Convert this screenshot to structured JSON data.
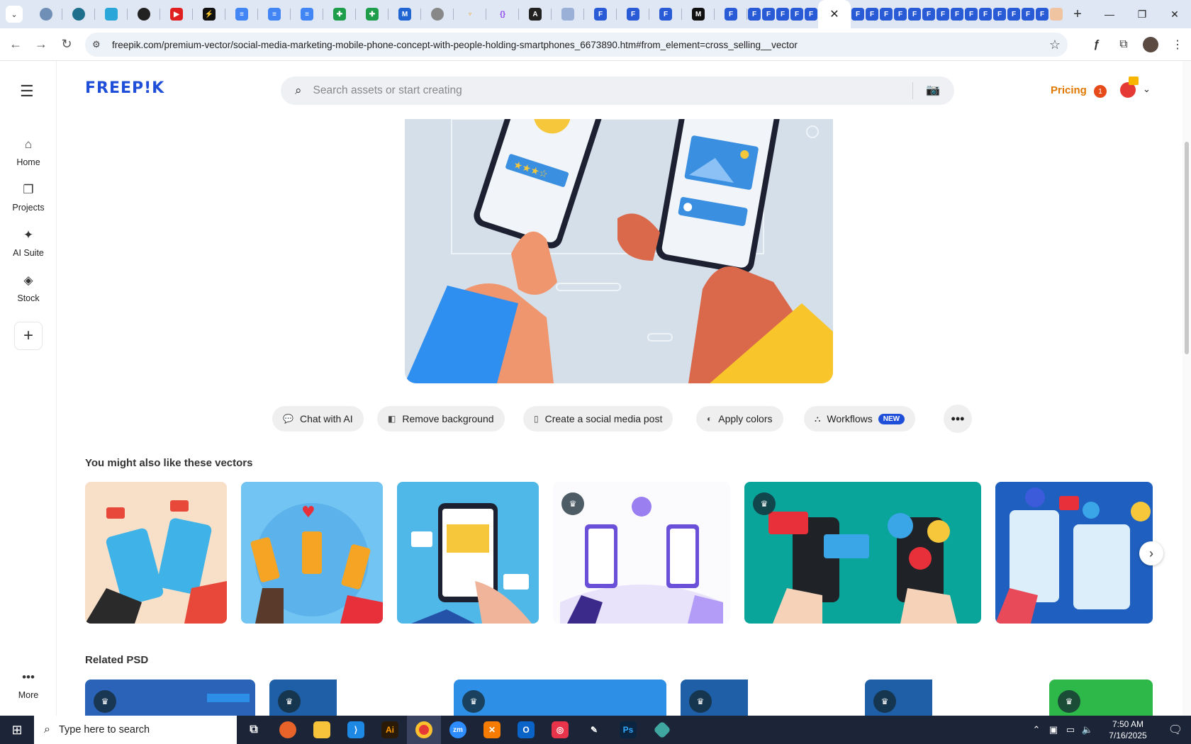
{
  "browser": {
    "tabs_count_visible": 30,
    "active_tab_close": "✕",
    "new_tab": "+",
    "url": "freepik.com/premium-vector/social-media-marketing-mobile-phone-concept-with-people-holding-smartphones_6673890.htm#from_element=cross_selling__vector",
    "controls": {
      "minimize": "—",
      "restore": "❐",
      "close": "✕"
    }
  },
  "header": {
    "logo": "FREEP!K",
    "search_placeholder": "Search assets or start creating",
    "pricing": "Pricing",
    "notification_count": "1"
  },
  "sidebar": {
    "items": [
      {
        "label": "Home",
        "icon": "home-icon"
      },
      {
        "label": "Projects",
        "icon": "projects-icon"
      },
      {
        "label": "AI Suite",
        "icon": "sparkle-icon"
      },
      {
        "label": "Stock",
        "icon": "stock-icon"
      }
    ],
    "more": "More"
  },
  "actions": {
    "chat": "Chat with AI",
    "remove_bg": "Remove background",
    "social_post": "Create a social media post",
    "apply_colors": "Apply colors",
    "workflows": "Workflows",
    "new_badge": "NEW"
  },
  "sections": {
    "similar": "You might also like these vectors",
    "related_psd": "Related PSD"
  },
  "taskbar": {
    "search": "Type here to search",
    "time": "7:50 AM",
    "date": "7/16/2025"
  },
  "colors": {
    "brand": "#1f4fd8",
    "pricing": "#e07800",
    "hero_bg": "#d5dfea"
  }
}
